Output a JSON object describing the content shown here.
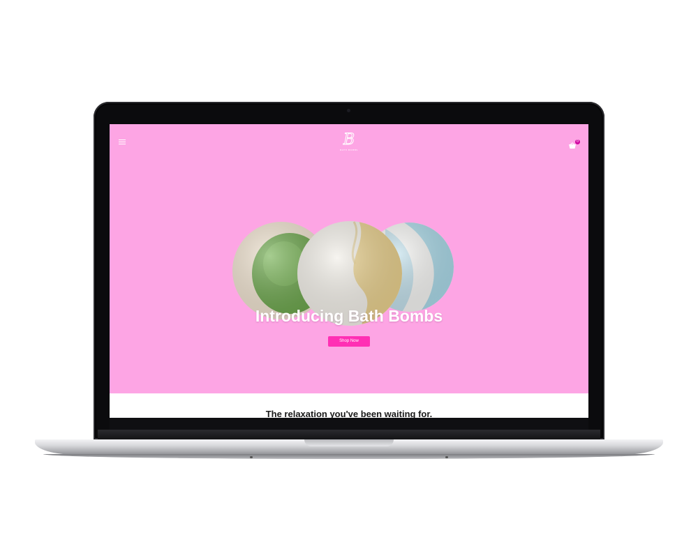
{
  "header": {
    "menu_icon": "hamburger-menu-icon",
    "logo_letter": "B",
    "logo_subtext": "BATH BOMBS",
    "cart_icon": "shopping-basket-icon",
    "cart_count": "0"
  },
  "hero": {
    "title": "Introducing Bath Bombs",
    "button_label": "Shop Now",
    "background_color": "#fda5e4",
    "button_color": "#ff2fb4"
  },
  "section": {
    "tagline": "The relaxation you've been waiting for."
  },
  "device": {
    "type": "laptop"
  }
}
